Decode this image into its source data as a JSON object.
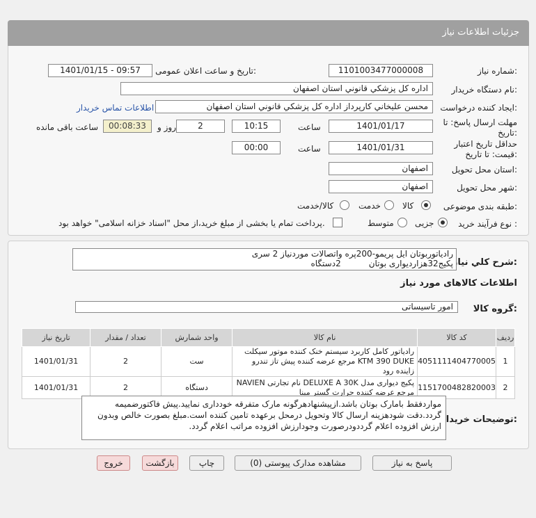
{
  "header": {
    "title": "جزئیات اطلاعات نیاز"
  },
  "form": {
    "need_number": {
      "label": "شماره نیاز:",
      "value": "1101003477000008"
    },
    "announce_datetime": {
      "label": "تاریخ و ساعت اعلان عمومی:",
      "value": "1401/01/15 - 09:57"
    },
    "buyer_org": {
      "label": "نام دستگاه خریدار:",
      "value": "اداره کل پزشکي قانوني استان اصفهان"
    },
    "requester": {
      "label": "ایجاد کننده درخواست:",
      "value": "محسن عليخاني کارپرداز اداره کل پزشکي قانوني استان اصفهان",
      "contact_link": "اطلاعات تماس خریدار"
    },
    "response_deadline": {
      "label_line1": "مهلت ارسال پاسخ: تا",
      "label_line2": "تاریخ:",
      "date": "1401/01/17",
      "time_label": "ساعت",
      "time": "10:15",
      "days": "2",
      "days_label": "روز و",
      "remaining": "00:08:33",
      "remaining_label": "ساعت باقی مانده"
    },
    "price_validity": {
      "label_line1": "حداقل تاریخ اعتبار",
      "label_line2": "قیمت: تا تاریخ:",
      "date": "1401/01/31",
      "time_label": "ساعت",
      "time": "00:00"
    },
    "delivery_province": {
      "label": "استان محل تحویل:",
      "value": "اصفهان"
    },
    "delivery_city": {
      "label": "شهر محل تحویل:",
      "value": "اصفهان"
    },
    "category": {
      "label": "طبقه بندی موضوعی:",
      "options": [
        "کالا",
        "خدمت",
        "کالا/خدمت"
      ],
      "selected": "کالا"
    },
    "process_type": {
      "label": "نوع فرآیند خرید :",
      "options": [
        "جزیی",
        "متوسط"
      ],
      "selected": "جزیی",
      "payment_note": "پرداخت تمام یا بخشی از مبلغ خرید،از محل \"اسناد خزانه اسلامی\" خواهد بود."
    }
  },
  "description": {
    "label": "شرح کلي نياز:",
    "line1": "رادياتوربوتان ايل پريمو-200پره واتصالات موردنياز 2 سری",
    "line2a": "پکيج32هزاردیواری بوتان",
    "line2b": "2دستگاه"
  },
  "goods_section": {
    "title": "اطلاعات کالاهای مورد نیاز",
    "group_label": "گروه کالا:",
    "group_value": "امور تاسیساتی"
  },
  "table": {
    "headers": [
      "ردیف",
      "کد کالا",
      "نام کالا",
      "واحد شمارش",
      "تعداد / مقدار",
      "تاریخ نیاز"
    ],
    "rows": [
      {
        "row": "1",
        "code": "4051111404770005",
        "name": "رادیاتور کامل کاربرد سیستم خنک کننده موتور سیکلت KTM 390 DUKE مرجع عرضه کننده پیش تاز تندرو زاینده رود",
        "unit": "ست",
        "qty": "2",
        "date": "1401/01/31"
      },
      {
        "row": "2",
        "code": "1151700482820003",
        "name": "پکیج دیواری مدل DELUXE A 30K نام تجارتی NAVIEN مرجع عرضه کننده حرارت گستر مبنا",
        "unit": "دستگاه",
        "qty": "2",
        "date": "1401/01/31"
      }
    ]
  },
  "buyer_notes": {
    "label": "توضیحات خریدار:",
    "text": "مواردفقط بامارک بوتان باشد.ازپیشنهادهرگونه مارک متفرقه خودداری نمایید.پیش فاکتورضمیمه گردد.دقت شودهزینه ارسال کالا وتحویل درمحل برعهده تامین کننده است.مبلغ بصورت خالص وبدون ارزش افزوده اعلام گرددودرصورت وجودارزش افزوده مراتب اعلام گردد."
  },
  "buttons": {
    "reply": "پاسخ به نیاز",
    "attachments": "مشاهده مدارک پیوستی (0)",
    "print": "چاپ",
    "back": "بازگشت",
    "exit": "خروج"
  }
}
